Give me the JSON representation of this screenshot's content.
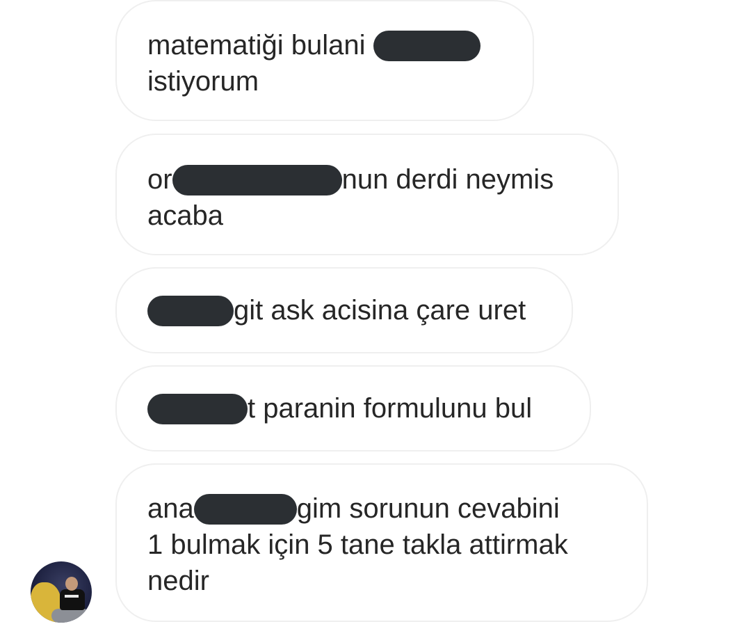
{
  "messages": [
    {
      "lines": [
        {
          "text": "matematiği bulani ",
          "redact_after": true
        },
        {
          "text": "istiyorum"
        }
      ]
    },
    {
      "lines": [
        {
          "text_before": "or",
          "text_after": "nun derdi neymis",
          "redacted_middle": true
        },
        {
          "text": "acaba"
        }
      ]
    },
    {
      "lines": [
        {
          "text": "git ask acisina çare uret",
          "redact_before": true
        }
      ]
    },
    {
      "lines": [
        {
          "text": "t paranin formulunu bul",
          "redact_before": true
        }
      ]
    },
    {
      "lines": [
        {
          "text_before": "ana",
          "text_after": "gim sorunun cevabini",
          "redacted_middle": true
        },
        {
          "text": "1 bulmak için 5 tane takla attirmak"
        },
        {
          "text": "nedir"
        }
      ]
    }
  ],
  "sender": {
    "avatar_icon": "profile-photo-avatar"
  },
  "colors": {
    "bubble_border": "#efefef",
    "text": "#262626",
    "redaction": "#2b2f33"
  }
}
